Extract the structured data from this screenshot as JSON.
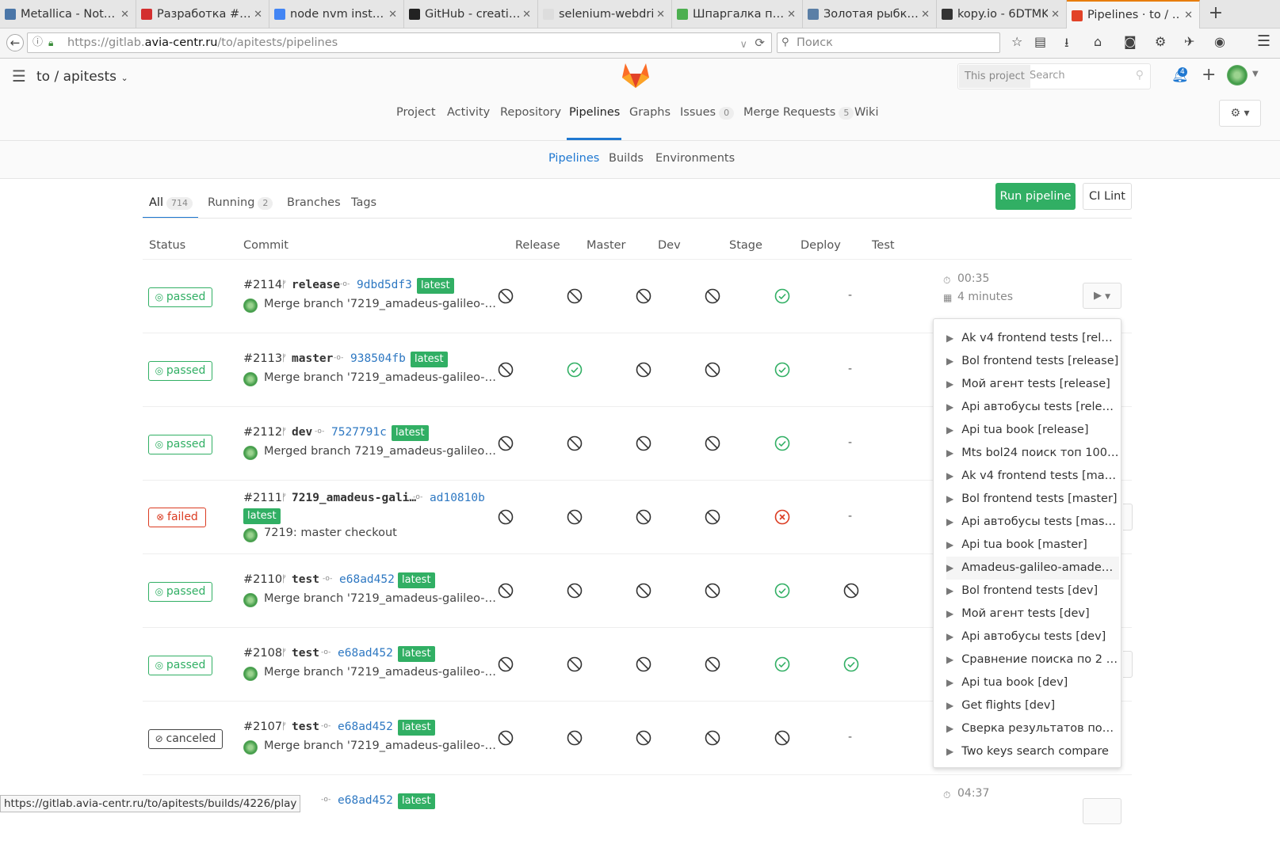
{
  "browser": {
    "tabs": [
      {
        "title": "Metallica - Not…",
        "icon": "vk-icon",
        "color": "#4a76a8"
      },
      {
        "title": "Разработка #…",
        "icon": "redmine-icon",
        "color": "#d32f2f"
      },
      {
        "title": "node nvm inst…",
        "icon": "google-icon",
        "color": "#4285f4"
      },
      {
        "title": "GitHub - creati…",
        "icon": "github-icon",
        "color": "#222222"
      },
      {
        "title": "selenium-webdri…",
        "icon": "blank-icon",
        "color": "#dddddd"
      },
      {
        "title": "Шпаргалка п…",
        "icon": "smile-icon",
        "color": "#4caf50"
      },
      {
        "title": "Золотая рыбк…",
        "icon": "gt-icon",
        "color": "#5b7fa6"
      },
      {
        "title": "kopy.io - 6DTMK",
        "icon": "kopy-icon",
        "color": "#333333"
      },
      {
        "title": "Pipelines · to / …",
        "icon": "gitlab-icon",
        "color": "#e24329"
      }
    ],
    "url_prefix": "https://gitlab.",
    "url_domain": "avia-centr.ru",
    "url_path": "/to/apitests/pipelines",
    "search_placeholder": "Поиск"
  },
  "header": {
    "project": "to / apitests",
    "search_scope": "This project",
    "search_placeholder": "Search",
    "notifications": "4"
  },
  "nav": {
    "project": "Project",
    "activity": "Activity",
    "repository": "Repository",
    "pipelines": "Pipelines",
    "graphs": "Graphs",
    "issues": "Issues",
    "issues_count": "0",
    "merge_requests": "Merge Requests",
    "mr_count": "5",
    "wiki": "Wiki"
  },
  "subnav": {
    "pipelines": "Pipelines",
    "builds": "Builds",
    "environments": "Environments"
  },
  "scope_tabs": {
    "all": "All",
    "all_count": "714",
    "running": "Running",
    "running_count": "2",
    "branches": "Branches",
    "tags": "Tags"
  },
  "buttons": {
    "run_pipeline": "Run pipeline",
    "ci_lint": "CI Lint"
  },
  "columns": {
    "status": "Status",
    "commit": "Commit",
    "release": "Release",
    "master": "Master",
    "dev": "Dev",
    "stage": "Stage",
    "deploy": "Deploy",
    "test": "Test"
  },
  "pipelines": [
    {
      "status": "passed",
      "id": "#2114",
      "ref": "release",
      "sha": "9dbd5df3",
      "latest": "latest",
      "message": "Merge branch '7219_amadeus-galileo-am…",
      "stages": [
        "skipped",
        "skipped",
        "skipped",
        "skipped",
        "success",
        "-"
      ],
      "duration": "00:35",
      "finished": "4 minutes"
    },
    {
      "status": "passed",
      "id": "#2113",
      "ref": "master",
      "sha": "938504fb",
      "latest": "latest",
      "message": "Merge branch '7219_amadeus-galileo-am…",
      "stages": [
        "skipped",
        "success",
        "skipped",
        "skipped",
        "success",
        "-"
      ]
    },
    {
      "status": "passed",
      "id": "#2112",
      "ref": "dev",
      "sha": "7527791c",
      "latest": "latest",
      "message": "Merged branch 7219_amadeus-galileo-a…",
      "stages": [
        "skipped",
        "skipped",
        "skipped",
        "skipped",
        "success",
        "-"
      ]
    },
    {
      "status": "failed",
      "id": "#2111",
      "ref": "7219_amadeus-gali…",
      "sha": "ad10810b",
      "latest": "latest",
      "message": "7219: master checkout",
      "stages": [
        "skipped",
        "skipped",
        "skipped",
        "skipped",
        "failed",
        "-"
      ]
    },
    {
      "status": "passed",
      "id": "#2110",
      "ref": "test",
      "sha": "e68ad452",
      "latest": "latest",
      "message": "Merge branch '7219_amadeus-galileo-am…",
      "stages": [
        "skipped",
        "skipped",
        "skipped",
        "skipped",
        "success",
        "skipped"
      ]
    },
    {
      "status": "passed",
      "id": "#2108",
      "ref": "test",
      "sha": "e68ad452",
      "latest": "latest",
      "message": "Merge branch '7219_amadeus-galileo-am…",
      "stages": [
        "skipped",
        "skipped",
        "skipped",
        "skipped",
        "success",
        "success"
      ]
    },
    {
      "status": "canceled",
      "id": "#2107",
      "ref": "test",
      "sha": "e68ad452",
      "latest": "latest",
      "message": "Merge branch '7219_amadeus-galileo-am…",
      "stages": [
        "skipped",
        "skipped",
        "skipped",
        "skipped",
        "skipped",
        "-"
      ]
    }
  ],
  "partial_row": {
    "sha": "e68ad452",
    "latest": "latest",
    "duration": "04:37"
  },
  "manual_actions": [
    "Ak v4 frontend tests [release]",
    "Bol frontend tests [release]",
    "Мой агент tests [release]",
    "Api автобусы tests [release]",
    "Api tua book [release]",
    "Mts bol24 поиск топ 100 [re…",
    "Ak v4 frontend tests [master]",
    "Bol frontend tests [master]",
    "Api автобусы tests [master]",
    "Api tua book [master]",
    "Amadeus-galileo-amadeus[…",
    "Bol frontend tests [dev]",
    "Мой агент tests [dev]",
    "Api автобусы tests [dev]",
    "Сравнение поиска по 2 кл…",
    "Api tua book [dev]",
    "Get flights [dev]",
    "Сверка результатов поиск…",
    "Two keys search compare"
  ],
  "status_url": "https://gitlab.avia-centr.ru/to/apitests/builds/4226/play",
  "colors": {
    "success": "#31af64",
    "failed": "#db3b21",
    "link": "#2e78c2",
    "accent": "#1f78d1"
  }
}
